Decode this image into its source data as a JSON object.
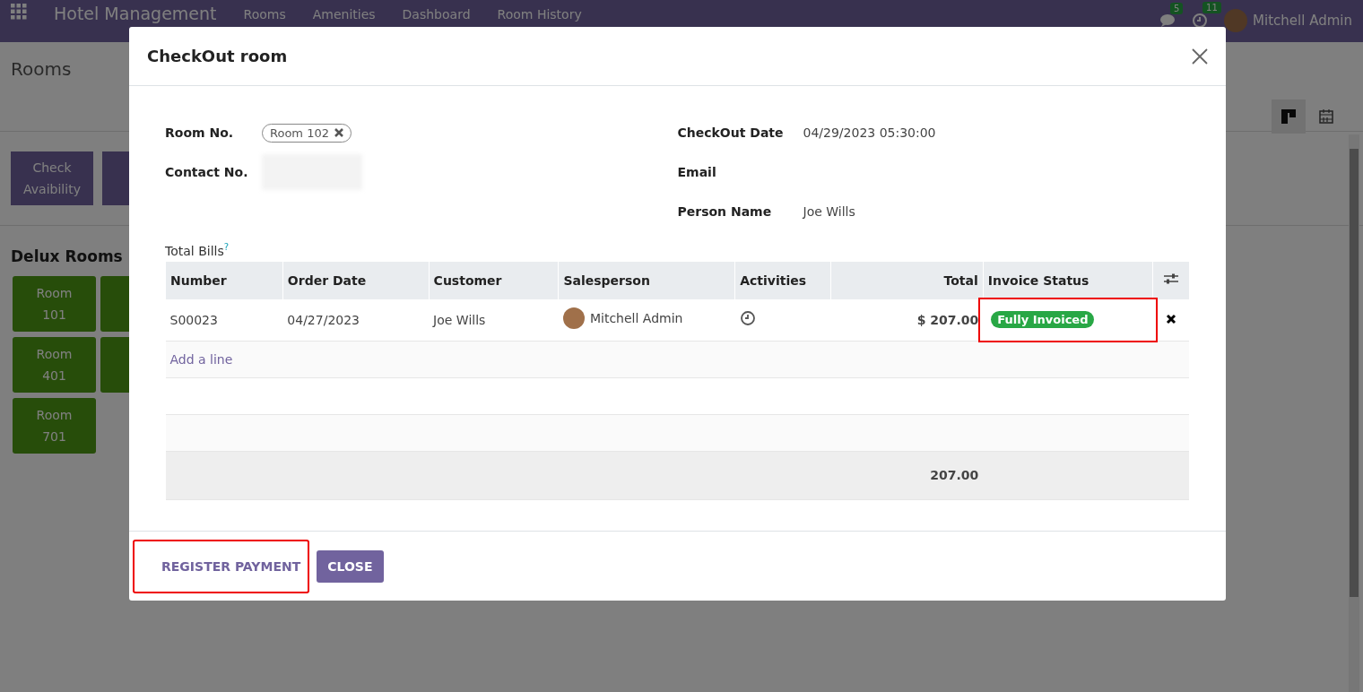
{
  "navbar": {
    "app_name": "Hotel Management",
    "menu": [
      "Rooms",
      "Amenities",
      "Dashboard",
      "Room History"
    ],
    "messages_count": "5",
    "activities_count": "11",
    "user": "Mitchell Admin"
  },
  "control_panel": {
    "title": "Rooms",
    "views": [
      {
        "kind": "kanban",
        "selected": true
      },
      {
        "kind": "calendar",
        "selected": false
      }
    ]
  },
  "actions": [
    {
      "kind": "labeled",
      "lines": [
        "Check",
        "Avaibility"
      ]
    },
    {
      "kind": "covered"
    }
  ],
  "section_title": "Delux Rooms",
  "room_tiles": [
    {
      "kind": "labeled",
      "lines": [
        "Room",
        "101"
      ]
    },
    {
      "kind": "covered"
    },
    {
      "kind": "labeled",
      "lines": [
        "Room",
        "401"
      ]
    },
    {
      "kind": "covered"
    },
    {
      "kind": "labeled",
      "lines": [
        "Room",
        "701"
      ]
    }
  ],
  "dialog": {
    "title": "CheckOut room",
    "left_fields": [
      {
        "label": "Room No.",
        "kind": "tag",
        "value": "Room 102"
      },
      {
        "label": "Contact No.",
        "kind": "redacted"
      }
    ],
    "right_fields": [
      {
        "label": "CheckOut Date",
        "kind": "text",
        "value": "04/29/2023 05:30:00"
      },
      {
        "label": "Email",
        "kind": "empty"
      },
      {
        "label": "Person Name",
        "kind": "text",
        "value": "Joe Wills"
      }
    ],
    "bills_label": "Total Bills$^{?}$",
    "columns": [
      {
        "label": "Number",
        "kind": "text"
      },
      {
        "label": "Order Date",
        "kind": "text"
      },
      {
        "label": "Customer",
        "kind": "text"
      },
      {
        "label": "Salesperson",
        "kind": "text"
      },
      {
        "label": "Activities",
        "kind": "text"
      },
      {
        "label": "Total",
        "kind": "amount"
      },
      {
        "label": "Invoice Status",
        "kind": "text"
      }
    ],
    "rows": [
      {
        "number": "S00023",
        "order_date": "04/27/2023",
        "customer": "Joe Wills",
        "salesperson": "Mitchell Admin",
        "total": "$ 207.00",
        "invoice_status": "Fully Invoiced",
        "status_highlighted": true
      }
    ],
    "add_line": "Add a line",
    "sum_total": "207.00",
    "buttons": [
      {
        "label": "REGISTER PAYMENT",
        "kind": "link",
        "highlighted": true
      },
      {
        "label": "CLOSE",
        "kind": "primary",
        "highlighted": false
      }
    ]
  }
}
